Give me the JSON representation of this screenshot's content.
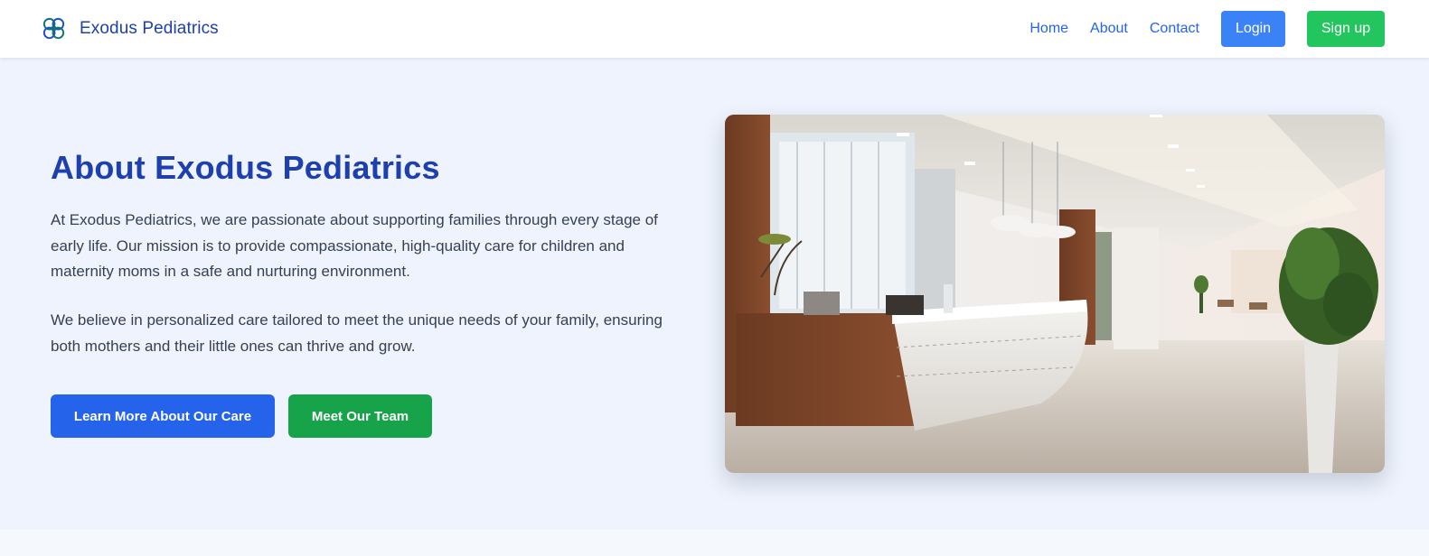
{
  "brand": {
    "name": "Exodus Pediatrics",
    "logo_icon": "clover-logo-icon"
  },
  "nav": {
    "links": [
      "Home",
      "About",
      "Contact"
    ],
    "login_label": "Login",
    "signup_label": "Sign up"
  },
  "hero": {
    "title": "About Exodus Pediatrics",
    "paragraphs": [
      "At Exodus Pediatrics, we are passionate about supporting families through every stage of early life. Our mission is to provide compassionate, high-quality care for children and maternity moms in a safe and nurturing environment.",
      "We believe in personalized care tailored to meet the unique needs of your family, ensuring both mothers and their little ones can thrive and grow."
    ],
    "primary_button": "Learn More About Our Care",
    "secondary_button": "Meet Our Team",
    "image_alt": "clinic-reception-photo"
  },
  "colors": {
    "brand_blue": "#1e40af",
    "link_blue": "#2563eb",
    "login_blue": "#3b82f6",
    "signup_green": "#22c55e",
    "team_green": "#16a34a",
    "hero_bg": "#eef3fd"
  }
}
